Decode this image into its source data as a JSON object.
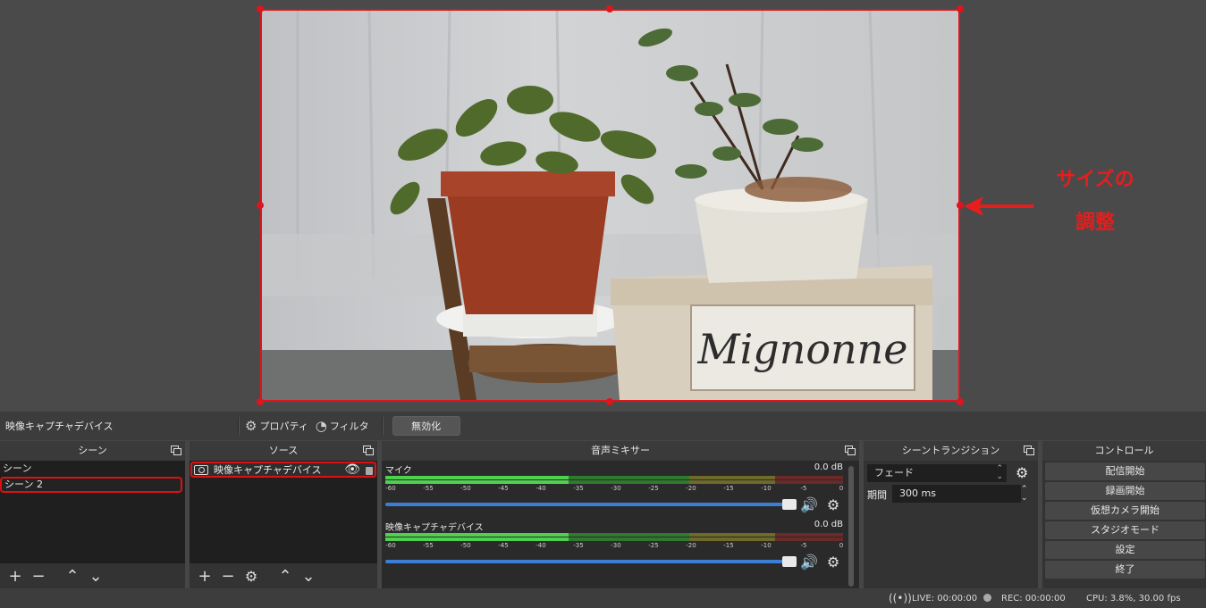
{
  "annotation": {
    "line1": "サイズの",
    "line2": "調整",
    "color": "#e51e1e"
  },
  "preview": {
    "photo_text": "Mignonne"
  },
  "context_bar": {
    "source_name": "映像キャプチャデバイス",
    "properties_label": "プロパティ",
    "filters_label": "フィルタ",
    "disable_label": "無効化"
  },
  "scenes": {
    "title": "シーン",
    "items": [
      "シーン",
      "シーン 2"
    ]
  },
  "sources": {
    "title": "ソース",
    "items": [
      "映像キャプチャデバイス"
    ]
  },
  "mixer": {
    "title": "音声ミキサー",
    "ticks": [
      "-60",
      "-55",
      "-50",
      "-45",
      "-40",
      "-35",
      "-30",
      "-25",
      "-20",
      "-15",
      "-10",
      "-5",
      "0"
    ],
    "channels": [
      {
        "name": "マイク",
        "level": "0.0 dB"
      },
      {
        "name": "映像キャプチャデバイス",
        "level": "0.0 dB"
      }
    ]
  },
  "transitions": {
    "title": "シーントランジション",
    "selected": "フェード",
    "duration_label": "期間",
    "duration_value": "300 ms"
  },
  "controls": {
    "title": "コントロール",
    "buttons": [
      "配信開始",
      "録画開始",
      "仮想カメラ開始",
      "スタジオモード",
      "設定",
      "終了"
    ]
  },
  "status": {
    "live": "LIVE: 00:00:00",
    "rec": "REC: 00:00:00",
    "cpu": "CPU: 3.8%, 30.00 fps"
  },
  "colors": {
    "selection_red": "#e0141c",
    "fader_blue": "#3b7ed4",
    "meter_green": "#4fd14f"
  }
}
